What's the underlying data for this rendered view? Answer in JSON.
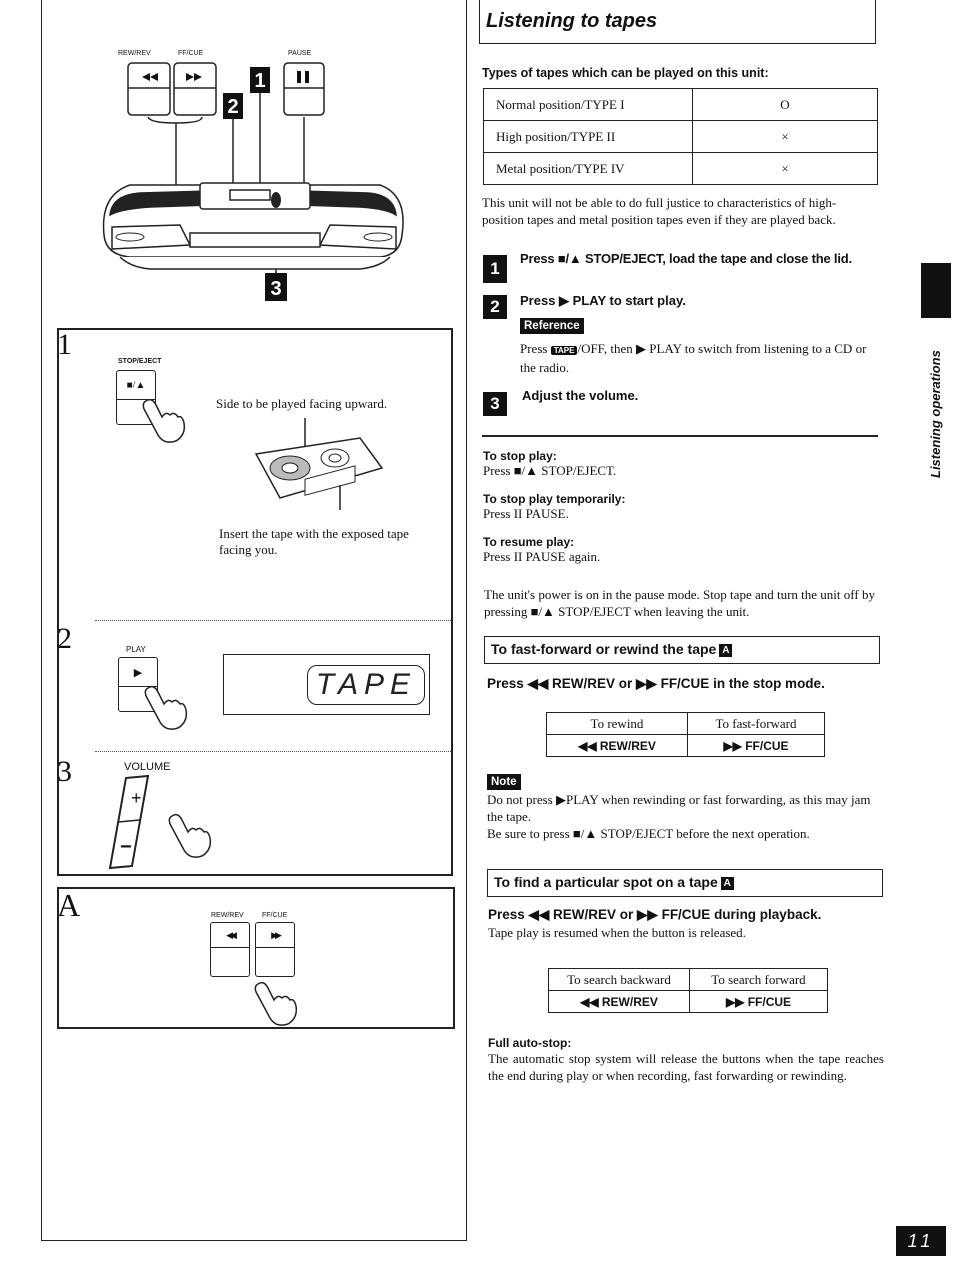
{
  "page": {
    "title": "Listening to tapes",
    "side_tab": "Listening operations",
    "page_number": "11"
  },
  "illustration": {
    "top_labels": {
      "rew": "REW/REV",
      "ff": "FF/CUE",
      "pause": "PAUSE"
    },
    "callouts": [
      "1",
      "2",
      "3"
    ],
    "step1": {
      "badge": "1",
      "button_label": "STOP/EJECT",
      "button_symbol": "■/▲",
      "caption_top": "Side to be played facing upward.",
      "caption_bottom": "Insert the tape with the exposed tape facing you."
    },
    "step2": {
      "badge": "2",
      "button_label": "PLAY",
      "button_symbol": "▶",
      "display_text": "TAPE"
    },
    "step3": {
      "badge": "3",
      "label": "VOLUME",
      "plus": "+",
      "minus": "−"
    },
    "stepA": {
      "badge": "A",
      "rew_label": "REW/REV",
      "ff_label": "FF/CUE",
      "rew_symbol": "◀◀",
      "ff_symbol": "▶▶"
    }
  },
  "tape_types": {
    "heading": "Types of tapes which can be played on this unit:",
    "rows": [
      {
        "type": "Normal position/TYPE I",
        "supported": "O"
      },
      {
        "type": "High position/TYPE II",
        "supported": "×"
      },
      {
        "type": "Metal position/TYPE IV",
        "supported": "×"
      }
    ],
    "note": "This unit will not be able to do full justice to characteristics of high-position tapes and metal position tapes even if they are played back."
  },
  "steps": [
    {
      "num": "1",
      "text": "Press ■/▲ STOP/EJECT, load the tape and close the lid."
    },
    {
      "num": "2",
      "text": "Press ▶ PLAY to start play."
    },
    {
      "num": "3",
      "text": "Adjust the volume."
    }
  ],
  "reference": {
    "label": "Reference",
    "pre": "Press",
    "tape_key": "TAPE",
    "post": "/OFF, then ▶ PLAY to switch from listening to a CD or the radio."
  },
  "tips": [
    {
      "title": "To stop play:",
      "text": "Press ■/▲ STOP/EJECT."
    },
    {
      "title": "To stop play temporarily:",
      "text": "Press II PAUSE."
    },
    {
      "title": "To resume play:",
      "text": "Press II PAUSE again."
    }
  ],
  "pause_note": "The unit's power is on in the pause mode. Stop tape and turn the unit off by pressing ■/▲ STOP/EJECT when leaving the unit.",
  "fast_forward": {
    "heading": "To fast-forward or rewind the tape",
    "badge": "A",
    "instruction": "Press ◀◀ REW/REV or ▶▶ FF/CUE in the stop mode.",
    "table": {
      "headers": [
        "To rewind",
        "To fast-forward"
      ],
      "values": [
        "◀◀ REW/REV",
        "▶▶ FF/CUE"
      ]
    },
    "note_label": "Note",
    "notes": [
      "Do not press ▶PLAY when rewinding or fast forwarding, as this may jam the tape.",
      "Be sure to press ■/▲ STOP/EJECT before the next operation."
    ]
  },
  "find_spot": {
    "heading": "To find a particular spot on a tape",
    "badge": "A",
    "instruction": "Press ◀◀ REW/REV or ▶▶ FF/CUE during playback.",
    "sub": "Tape play is resumed when the button is released.",
    "table": {
      "headers": [
        "To search backward",
        "To search forward"
      ],
      "values": [
        "◀◀ REW/REV",
        "▶▶ FF/CUE"
      ]
    }
  },
  "auto_stop": {
    "title": "Full auto-stop:",
    "text": "The automatic stop system will release the buttons when the tape reaches the end during play or when recording, fast forwarding or rewinding."
  }
}
